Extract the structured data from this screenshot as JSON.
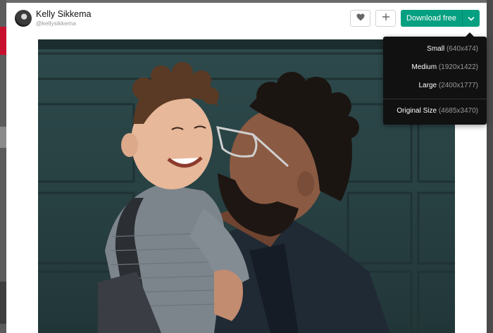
{
  "author": {
    "name": "Kelly Sikkema",
    "handle": "@kellysikkema"
  },
  "actions": {
    "like_icon": "heart-icon",
    "collect_icon": "plus-icon",
    "download_label": "Download free",
    "download_toggle_icon": "chevron-down-icon"
  },
  "photo": {
    "subject": "photo-father-kissing-toddler"
  },
  "download_menu": {
    "items": [
      {
        "label": "Small",
        "dims": "(640x474)"
      },
      {
        "label": "Medium",
        "dims": "(1920x1422)"
      },
      {
        "label": "Large",
        "dims": "(2400x1777)"
      },
      {
        "label": "Original Size",
        "dims": "(4685x3470)"
      }
    ]
  },
  "colors": {
    "accent": "#05a081",
    "menu_bg": "#111111"
  }
}
